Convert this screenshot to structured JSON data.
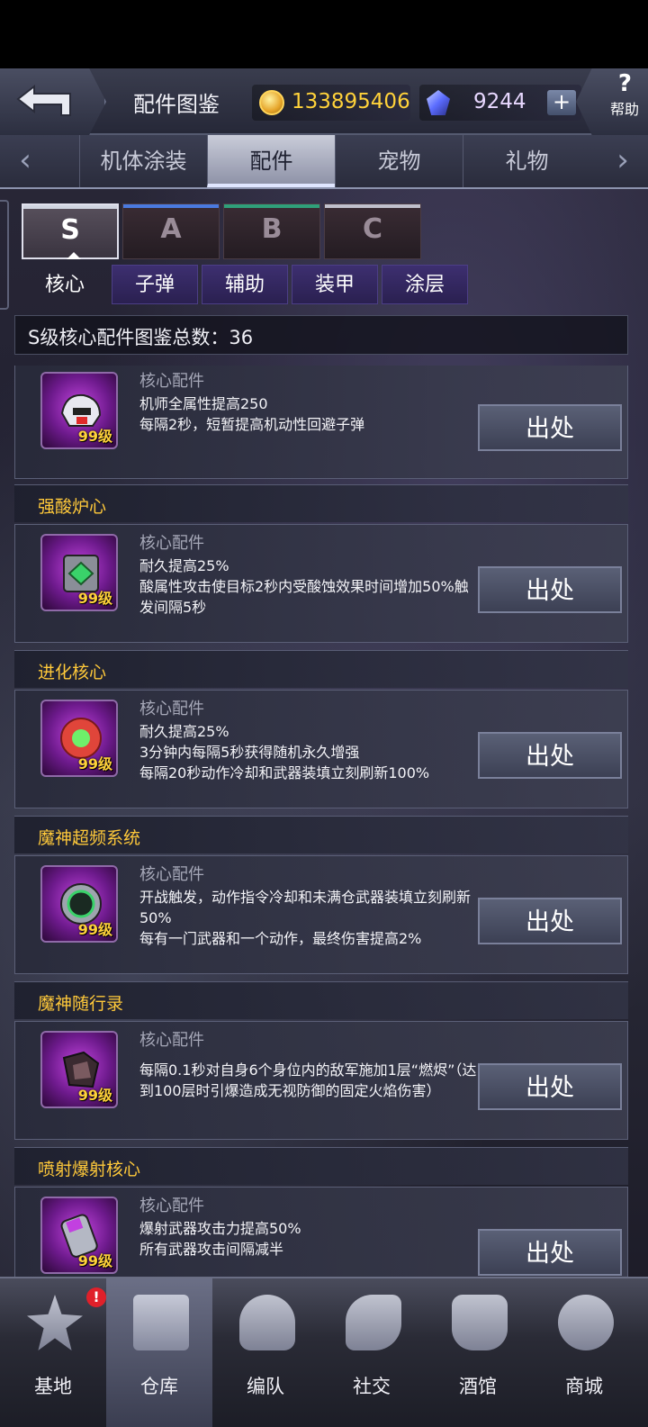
{
  "header": {
    "title": "配件图鉴",
    "gold": "133895406",
    "gems": "9244",
    "plus": "+",
    "help_icon": "?",
    "help": "帮助"
  },
  "tabs": {
    "left_arrow": "‹",
    "right_arrow": "›",
    "items": [
      {
        "label": "机体涂装"
      },
      {
        "label": "配件"
      },
      {
        "label": "宠物"
      },
      {
        "label": "礼物"
      }
    ],
    "active_index": 1
  },
  "grades": [
    {
      "label": "S",
      "color": "#d0d4e0"
    },
    {
      "label": "A",
      "color": "#4a7adf"
    },
    {
      "label": "B",
      "color": "#2fa07a"
    },
    {
      "label": "C",
      "color": "#c0c0cc"
    }
  ],
  "subtypes": [
    "核心",
    "子弹",
    "辅助",
    "装甲",
    "涂层"
  ],
  "count_label": "S级核心配件图鉴总数：36",
  "items": [
    {
      "name": "",
      "type": "核心配件",
      "level": "99级",
      "desc": [
        "机师全属性提高250",
        "每隔2秒，短暂提高机动性回避子弹"
      ],
      "source": "出处"
    },
    {
      "name": "强酸炉心",
      "type": "核心配件",
      "level": "99级",
      "desc": [
        "耐久提高25%",
        "酸属性攻击使目标2秒内受酸蚀效果时间增加50%触发间隔5秒"
      ],
      "source": "出处"
    },
    {
      "name": "进化核心",
      "type": "核心配件",
      "level": "99级",
      "desc": [
        "耐久提高25%",
        "3分钟内每隔5秒获得随机永久增强",
        "每隔20秒动作冷却和武器装填立刻刷新100%"
      ],
      "source": "出处"
    },
    {
      "name": "魔神超频系统",
      "type": "核心配件",
      "level": "99级",
      "desc": [
        "开战触发，动作指令冷却和未满仓武器装填立刻刷新50%",
        "每有一门武器和一个动作，最终伤害提高2%"
      ],
      "source": "出处"
    },
    {
      "name": "魔神随行录",
      "type": "核心配件",
      "level": "99级",
      "desc": [
        "每隔0.1秒对自身6个身位内的敌军施加1层“燃烬”（达到100层时引爆造成无视防御的固定火焰伤害）"
      ],
      "source": "出处"
    },
    {
      "name": "喷射爆射核心",
      "type": "核心配件",
      "level": "99级",
      "desc": [
        "爆射武器攻击力提高50%",
        "所有武器攻击间隔减半"
      ],
      "source": "出处"
    }
  ],
  "bottom_nav": [
    {
      "label": "基地",
      "icon": "base-icon",
      "badge": "!"
    },
    {
      "label": "仓库",
      "icon": "warehouse-icon"
    },
    {
      "label": "编队",
      "icon": "formation-icon"
    },
    {
      "label": "社交",
      "icon": "handshake-icon"
    },
    {
      "label": "酒馆",
      "icon": "tavern-icon"
    },
    {
      "label": "商城",
      "icon": "shop-icon"
    }
  ]
}
